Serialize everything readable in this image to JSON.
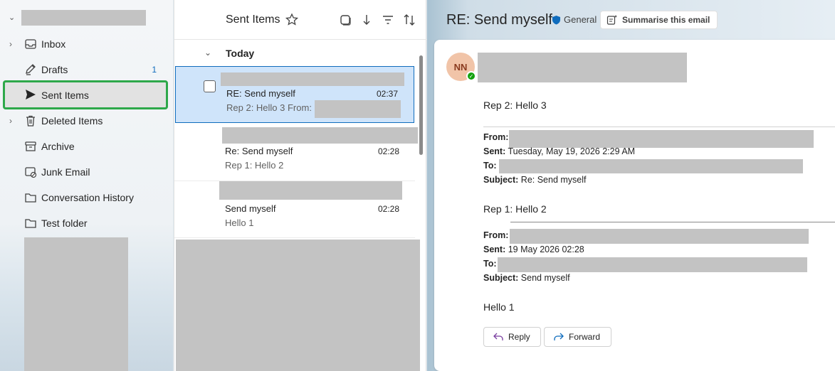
{
  "folders": {
    "items": [
      {
        "label": "Inbox",
        "count": "",
        "expandable": true
      },
      {
        "label": "Drafts",
        "count": "1",
        "expandable": false
      },
      {
        "label": "Sent Items",
        "count": "",
        "expandable": false
      },
      {
        "label": "Deleted Items",
        "count": "",
        "expandable": true
      },
      {
        "label": "Archive",
        "count": "",
        "expandable": false
      },
      {
        "label": "Junk Email",
        "count": "",
        "expandable": false
      },
      {
        "label": "Conversation History",
        "count": "",
        "expandable": false
      },
      {
        "label": "Test folder",
        "count": "",
        "expandable": false
      }
    ],
    "selected": "Sent Items"
  },
  "list": {
    "title": "Sent Items",
    "group": "Today",
    "mails": [
      {
        "subject": "RE: Send myself",
        "time": "02:37",
        "preview": "Rep 2: Hello 3 From:"
      },
      {
        "subject": "Re: Send myself",
        "time": "02:28",
        "preview": "Rep 1: Hello 2"
      },
      {
        "subject": "Send myself",
        "time": "02:28",
        "preview": "Hello 1"
      }
    ]
  },
  "reading": {
    "title": "RE: Send myself",
    "sensitivity": "General",
    "summarise": "Summarise this email",
    "avatar_initials": "NN",
    "body1": "Rep 2: Hello 3",
    "block1": {
      "from_label": "From:",
      "sent_label": "Sent:",
      "sent_value": "Tuesday, May 19, 2026 2:29 AM",
      "to_label": "To:",
      "subject_label": "Subject:",
      "subject_value": "Re: Send myself"
    },
    "body2": "Rep 1: Hello 2",
    "block2": {
      "from_label": "From:",
      "sent_label": "Sent:",
      "sent_value": "19 May 2026 02:28",
      "to_label": "To:",
      "subject_label": "Subject:",
      "subject_value": "Send myself"
    },
    "body3": "Hello 1",
    "reply": "Reply",
    "forward": "Forward"
  },
  "colors": {
    "accent": "#0f6cbd",
    "selection_outline": "#2ea84a",
    "presence": "#13a10e"
  }
}
